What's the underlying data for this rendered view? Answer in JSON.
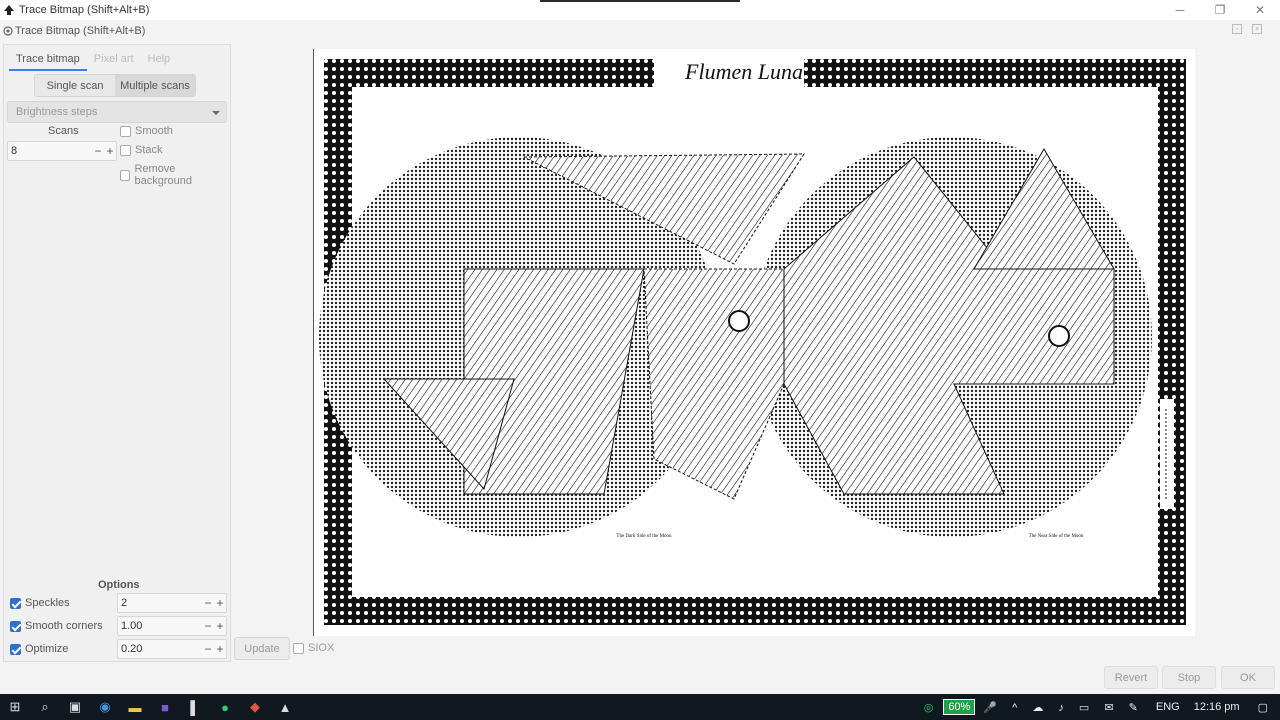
{
  "window": {
    "title": "Trace Bitmap (Shift+Alt+B)"
  },
  "dialog": {
    "title": "Trace Bitmap (Shift+Alt+B)"
  },
  "tabs": [
    "Trace bitmap",
    "Pixel art",
    "Help"
  ],
  "scan_mode": {
    "single": "Single scan",
    "multiple": "Multiple scans",
    "selected": "Multiple scans"
  },
  "detection": {
    "selected": "Brightness steps"
  },
  "scans": {
    "label": "Scans",
    "value": "8"
  },
  "checks": {
    "smooth": "Smooth",
    "stack": "Stack",
    "remove_bg": "Remove background"
  },
  "options": {
    "title": "Options",
    "speckles": {
      "label": "Speckles",
      "value": "2",
      "checked": true
    },
    "smooth_corners": {
      "label": "Smooth corners",
      "value": "1.00",
      "checked": true
    },
    "optimize": {
      "label": "Optimize",
      "value": "0.20",
      "checked": true
    }
  },
  "buttons": {
    "update": "Update",
    "siox": "SIOX",
    "revert": "Revert",
    "stop": "Stop",
    "ok": "OK"
  },
  "preview": {
    "heading": "Flumen Luna",
    "caption_left": "The Dark Side of the Moon",
    "caption_right": "The Near Side of the Moon"
  },
  "taskbar": {
    "battery": "60%",
    "language": "ENG",
    "time": "12:16 pm"
  },
  "colors": {
    "accent": "#3584e4",
    "checkbox": "#2f6fcf",
    "taskbar": "#101820",
    "battery": "#1aa34a"
  }
}
